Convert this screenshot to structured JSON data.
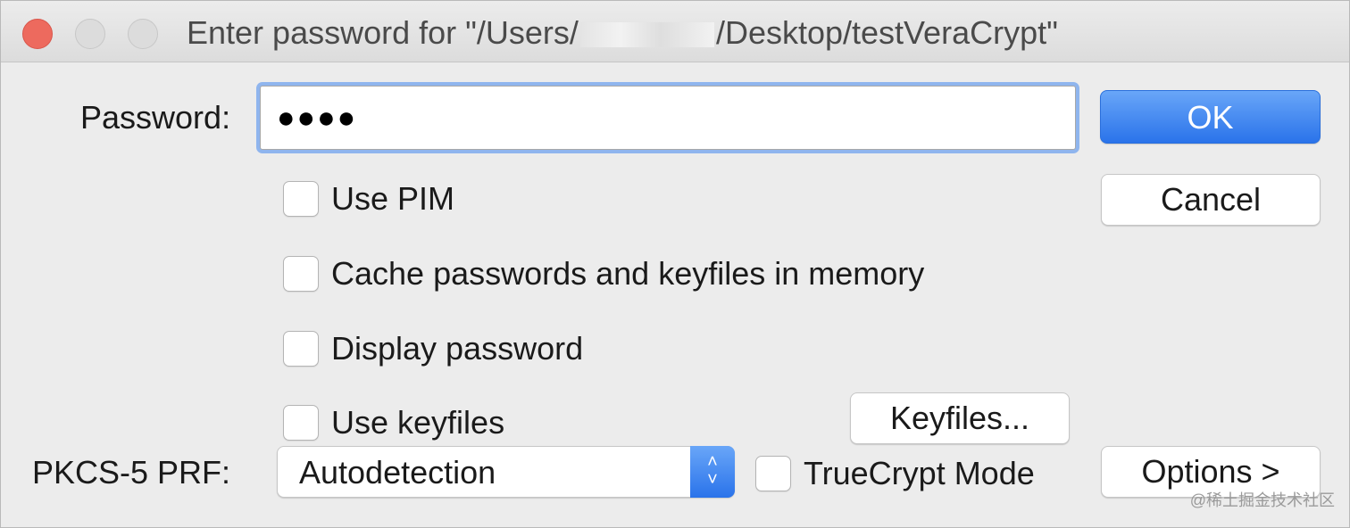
{
  "window": {
    "title_prefix": "Enter password for \"/Users/",
    "title_suffix": "/Desktop/testVeraCrypt\""
  },
  "password": {
    "label": "Password:",
    "masked_value": "●●●●"
  },
  "buttons": {
    "ok": "OK",
    "cancel": "Cancel",
    "keyfiles": "Keyfiles...",
    "options": "Options >"
  },
  "checkboxes": {
    "use_pim": {
      "label": "Use PIM",
      "checked": false
    },
    "cache": {
      "label": "Cache passwords and keyfiles in memory",
      "checked": false
    },
    "display_password": {
      "label": "Display password",
      "checked": false
    },
    "use_keyfiles": {
      "label": "Use keyfiles",
      "checked": false
    },
    "truecrypt_mode": {
      "label": "TrueCrypt Mode",
      "checked": false
    }
  },
  "prf": {
    "label": "PKCS-5 PRF:",
    "selected": "Autodetection"
  },
  "watermark": "@稀土掘金技术社区",
  "colors": {
    "accent": "#2a73ea",
    "focus_ring": "#8fb5ee",
    "close": "#ed6a5e"
  },
  "icons": {
    "close": "close-traffic-light-icon",
    "minimize": "minimize-traffic-light-icon",
    "zoom": "zoom-traffic-light-icon",
    "select_arrows": "chevron-up-down-icon"
  }
}
